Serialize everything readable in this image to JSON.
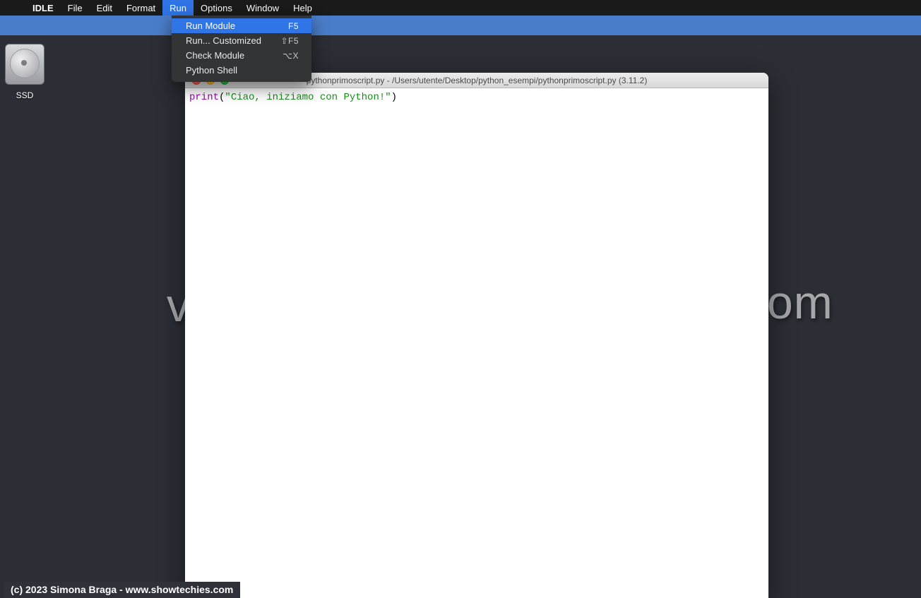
{
  "menubar": {
    "app": "IDLE",
    "items": [
      "File",
      "Edit",
      "Format",
      "Run",
      "Options",
      "Window",
      "Help"
    ],
    "active": "Run"
  },
  "dropdown": {
    "items": [
      {
        "label": "Run Module",
        "shortcut": "F5",
        "highlight": true
      },
      {
        "label": "Run... Customized",
        "shortcut": "⇧F5",
        "highlight": false
      },
      {
        "label": "Check Module",
        "shortcut": "⌥X",
        "highlight": false
      },
      {
        "label": "Python Shell",
        "shortcut": "",
        "highlight": false
      }
    ]
  },
  "desktop_icon": {
    "label": "SSD"
  },
  "window": {
    "title": "pythonprimoscript.py - /Users/utente/Desktop/python_esempi/pythonprimoscript.py (3.11.2)"
  },
  "code": {
    "func": "print",
    "open": "(",
    "string": "\"Ciao, iniziamo con Python!\"",
    "close": ")"
  },
  "watermark": {
    "left": "v",
    "right": "om"
  },
  "copyright": "(c) 2023 Simona Braga - www.showtechies.com"
}
